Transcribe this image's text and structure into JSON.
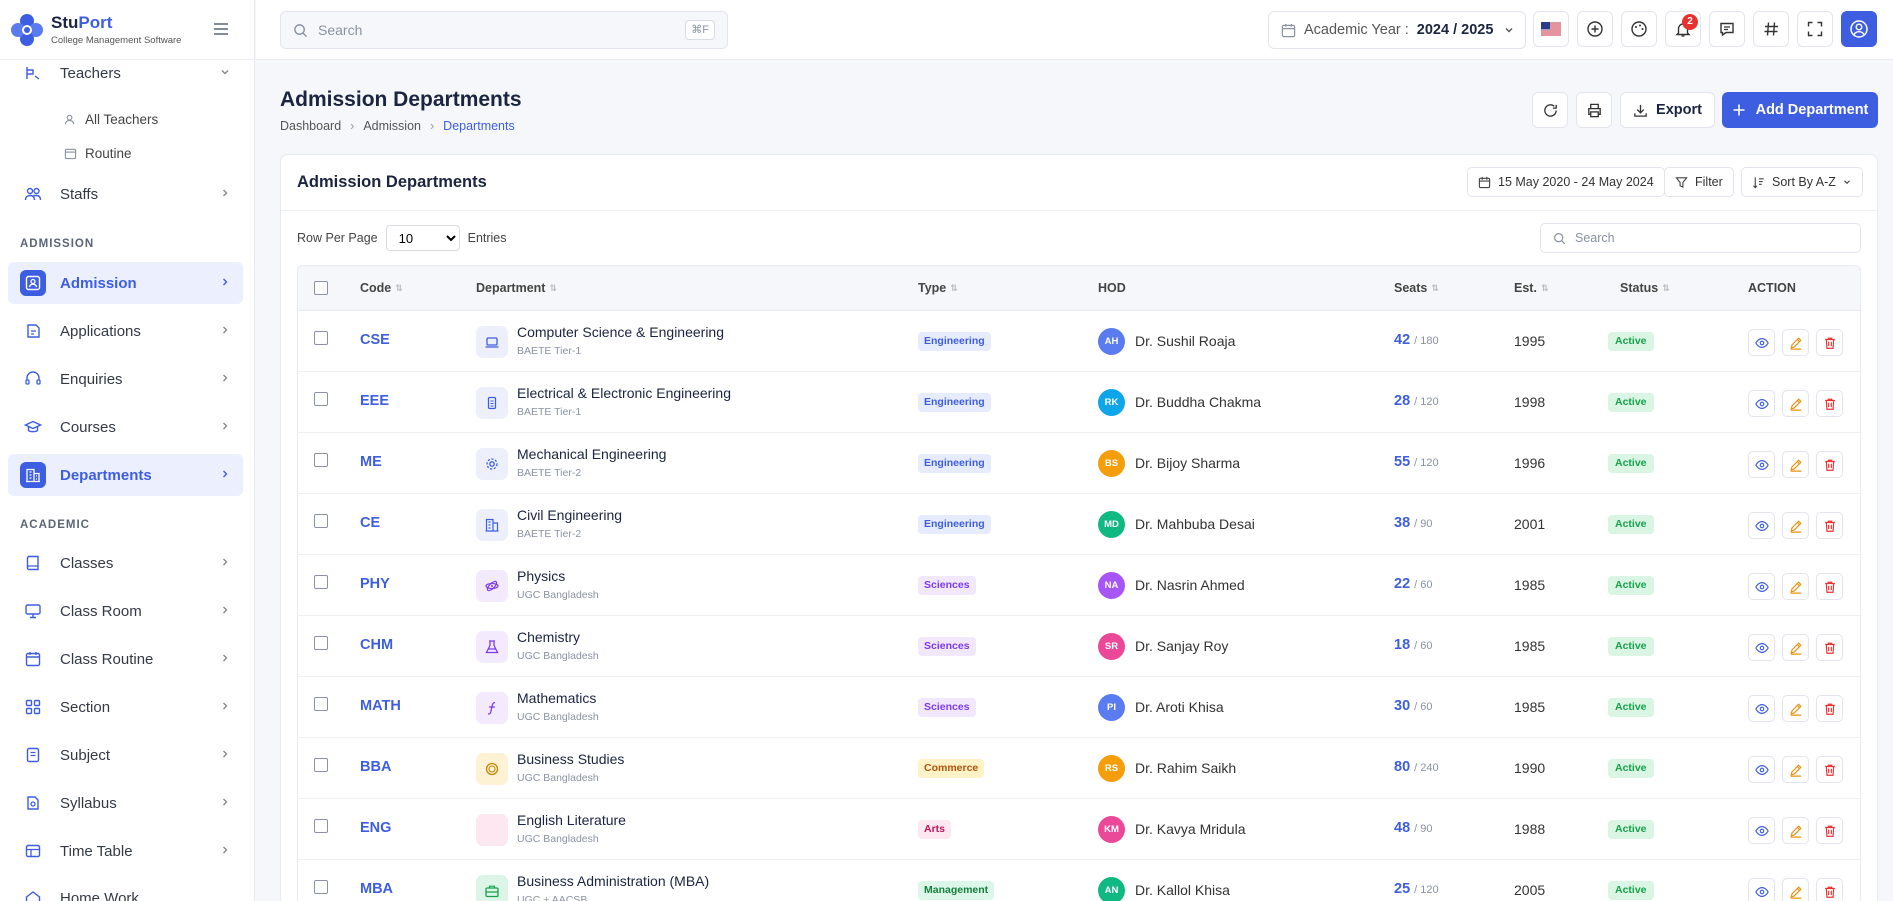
{
  "app": {
    "name_part1": "Stu",
    "name_part2": "Port",
    "tagline": "College Management Software"
  },
  "header": {
    "search_placeholder": "Search",
    "search_shortcut": "⌘F",
    "academic_year_label": "Academic Year :",
    "academic_year_value": "2024 / 2025",
    "notification_count": "2"
  },
  "sidebar": {
    "partial_item": "Teachers",
    "sub_items": [
      "All Teachers",
      "Routine"
    ],
    "staffs": "Staffs",
    "section_admission": "ADMISSION",
    "admission_items": [
      "Admission",
      "Applications",
      "Enquiries",
      "Courses",
      "Departments"
    ],
    "section_academic": "ACADEMIC",
    "academic_items": [
      "Classes",
      "Class Room",
      "Class Routine",
      "Section",
      "Subject",
      "Syllabus",
      "Time Table",
      "Home Work"
    ]
  },
  "page": {
    "title": "Admission Departments",
    "breadcrumb": [
      "Dashboard",
      "Admission",
      "Departments"
    ],
    "export_label": "Export",
    "add_label": "Add Department"
  },
  "card": {
    "title": "Admission Departments",
    "date_range": "15 May 2020 - 24 May 2024",
    "filter_label": "Filter",
    "sort_label": "Sort By A-Z",
    "rows_per_page_label": "Row Per Page",
    "rows_per_page_value": "10",
    "entries_label": "Entries",
    "search_placeholder": "Search"
  },
  "table": {
    "headers": [
      "Code",
      "Department",
      "Type",
      "HOD",
      "Seats",
      "Est.",
      "Status",
      "ACTION"
    ],
    "rows": [
      {
        "code": "CSE",
        "name": "Computer Science & Engineering",
        "sub": "BAETE Tier-1",
        "type": "Engineering",
        "initials": "AH",
        "hod": "Dr. Sushil Roaja",
        "seats": "42",
        "total": "/ 180",
        "est": "1995",
        "status": "Active"
      },
      {
        "code": "EEE",
        "name": "Electrical & Electronic Engineering",
        "sub": "BAETE Tier-1",
        "type": "Engineering",
        "initials": "RK",
        "hod": "Dr. Buddha Chakma",
        "seats": "28",
        "total": "/ 120",
        "est": "1998",
        "status": "Active"
      },
      {
        "code": "ME",
        "name": "Mechanical Engineering",
        "sub": "BAETE Tier-2",
        "type": "Engineering",
        "initials": "BS",
        "hod": "Dr. Bijoy Sharma",
        "seats": "55",
        "total": "/ 120",
        "est": "1996",
        "status": "Active"
      },
      {
        "code": "CE",
        "name": "Civil Engineering",
        "sub": "BAETE Tier-2",
        "type": "Engineering",
        "initials": "MD",
        "hod": "Dr. Mahbuba Desai",
        "seats": "38",
        "total": "/ 90",
        "est": "2001",
        "status": "Active"
      },
      {
        "code": "PHY",
        "name": "Physics",
        "sub": "UGC Bangladesh",
        "type": "Sciences",
        "initials": "NA",
        "hod": "Dr. Nasrin Ahmed",
        "seats": "22",
        "total": "/ 60",
        "est": "1985",
        "status": "Active"
      },
      {
        "code": "CHM",
        "name": "Chemistry",
        "sub": "UGC Bangladesh",
        "type": "Sciences",
        "initials": "SR",
        "hod": "Dr. Sanjay Roy",
        "seats": "18",
        "total": "/ 60",
        "est": "1985",
        "status": "Active"
      },
      {
        "code": "MATH",
        "name": "Mathematics",
        "sub": "UGC Bangladesh",
        "type": "Sciences",
        "initials": "PI",
        "hod": "Dr. Aroti Khisa",
        "seats": "30",
        "total": "/ 60",
        "est": "1985",
        "status": "Active"
      },
      {
        "code": "BBA",
        "name": "Business Studies",
        "sub": "UGC Bangladesh",
        "type": "Commerce",
        "initials": "RS",
        "hod": "Dr. Rahim Saikh",
        "seats": "80",
        "total": "/ 240",
        "est": "1990",
        "status": "Active"
      },
      {
        "code": "ENG",
        "name": "English Literature",
        "sub": "UGC Bangladesh",
        "type": "Arts",
        "initials": "KM",
        "hod": "Dr. Kavya Mridula",
        "seats": "48",
        "total": "/ 90",
        "est": "1988",
        "status": "Active"
      },
      {
        "code": "MBA",
        "name": "Business Administration (MBA)",
        "sub": "UGC + AACSB",
        "type": "Management",
        "initials": "AN",
        "hod": "Dr. Kallol Khisa",
        "seats": "25",
        "total": "/ 120",
        "est": "2005",
        "status": "Active"
      }
    ]
  },
  "colors": {
    "primary": "#3d5ee1",
    "active_bg": "#ebeffe",
    "status_green": "#16a34a",
    "badge_red": "#e8322f"
  }
}
